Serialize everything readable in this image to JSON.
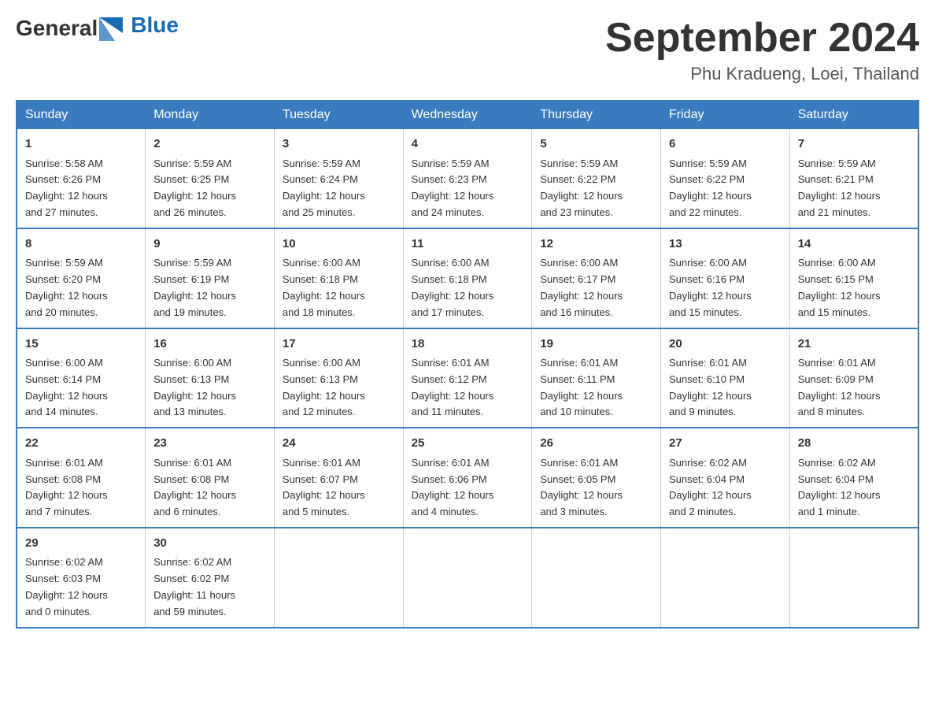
{
  "logo": {
    "text_general": "General",
    "text_blue": "Blue"
  },
  "header": {
    "title": "September 2024",
    "subtitle": "Phu Kradueng, Loei, Thailand"
  },
  "weekdays": [
    "Sunday",
    "Monday",
    "Tuesday",
    "Wednesday",
    "Thursday",
    "Friday",
    "Saturday"
  ],
  "weeks": [
    [
      {
        "day": "1",
        "sunrise": "5:58 AM",
        "sunset": "6:26 PM",
        "daylight": "12 hours and 27 minutes."
      },
      {
        "day": "2",
        "sunrise": "5:59 AM",
        "sunset": "6:25 PM",
        "daylight": "12 hours and 26 minutes."
      },
      {
        "day": "3",
        "sunrise": "5:59 AM",
        "sunset": "6:24 PM",
        "daylight": "12 hours and 25 minutes."
      },
      {
        "day": "4",
        "sunrise": "5:59 AM",
        "sunset": "6:23 PM",
        "daylight": "12 hours and 24 minutes."
      },
      {
        "day": "5",
        "sunrise": "5:59 AM",
        "sunset": "6:22 PM",
        "daylight": "12 hours and 23 minutes."
      },
      {
        "day": "6",
        "sunrise": "5:59 AM",
        "sunset": "6:22 PM",
        "daylight": "12 hours and 22 minutes."
      },
      {
        "day": "7",
        "sunrise": "5:59 AM",
        "sunset": "6:21 PM",
        "daylight": "12 hours and 21 minutes."
      }
    ],
    [
      {
        "day": "8",
        "sunrise": "5:59 AM",
        "sunset": "6:20 PM",
        "daylight": "12 hours and 20 minutes."
      },
      {
        "day": "9",
        "sunrise": "5:59 AM",
        "sunset": "6:19 PM",
        "daylight": "12 hours and 19 minutes."
      },
      {
        "day": "10",
        "sunrise": "6:00 AM",
        "sunset": "6:18 PM",
        "daylight": "12 hours and 18 minutes."
      },
      {
        "day": "11",
        "sunrise": "6:00 AM",
        "sunset": "6:18 PM",
        "daylight": "12 hours and 17 minutes."
      },
      {
        "day": "12",
        "sunrise": "6:00 AM",
        "sunset": "6:17 PM",
        "daylight": "12 hours and 16 minutes."
      },
      {
        "day": "13",
        "sunrise": "6:00 AM",
        "sunset": "6:16 PM",
        "daylight": "12 hours and 15 minutes."
      },
      {
        "day": "14",
        "sunrise": "6:00 AM",
        "sunset": "6:15 PM",
        "daylight": "12 hours and 15 minutes."
      }
    ],
    [
      {
        "day": "15",
        "sunrise": "6:00 AM",
        "sunset": "6:14 PM",
        "daylight": "12 hours and 14 minutes."
      },
      {
        "day": "16",
        "sunrise": "6:00 AM",
        "sunset": "6:13 PM",
        "daylight": "12 hours and 13 minutes."
      },
      {
        "day": "17",
        "sunrise": "6:00 AM",
        "sunset": "6:13 PM",
        "daylight": "12 hours and 12 minutes."
      },
      {
        "day": "18",
        "sunrise": "6:01 AM",
        "sunset": "6:12 PM",
        "daylight": "12 hours and 11 minutes."
      },
      {
        "day": "19",
        "sunrise": "6:01 AM",
        "sunset": "6:11 PM",
        "daylight": "12 hours and 10 minutes."
      },
      {
        "day": "20",
        "sunrise": "6:01 AM",
        "sunset": "6:10 PM",
        "daylight": "12 hours and 9 minutes."
      },
      {
        "day": "21",
        "sunrise": "6:01 AM",
        "sunset": "6:09 PM",
        "daylight": "12 hours and 8 minutes."
      }
    ],
    [
      {
        "day": "22",
        "sunrise": "6:01 AM",
        "sunset": "6:08 PM",
        "daylight": "12 hours and 7 minutes."
      },
      {
        "day": "23",
        "sunrise": "6:01 AM",
        "sunset": "6:08 PM",
        "daylight": "12 hours and 6 minutes."
      },
      {
        "day": "24",
        "sunrise": "6:01 AM",
        "sunset": "6:07 PM",
        "daylight": "12 hours and 5 minutes."
      },
      {
        "day": "25",
        "sunrise": "6:01 AM",
        "sunset": "6:06 PM",
        "daylight": "12 hours and 4 minutes."
      },
      {
        "day": "26",
        "sunrise": "6:01 AM",
        "sunset": "6:05 PM",
        "daylight": "12 hours and 3 minutes."
      },
      {
        "day": "27",
        "sunrise": "6:02 AM",
        "sunset": "6:04 PM",
        "daylight": "12 hours and 2 minutes."
      },
      {
        "day": "28",
        "sunrise": "6:02 AM",
        "sunset": "6:04 PM",
        "daylight": "12 hours and 1 minute."
      }
    ],
    [
      {
        "day": "29",
        "sunrise": "6:02 AM",
        "sunset": "6:03 PM",
        "daylight": "12 hours and 0 minutes."
      },
      {
        "day": "30",
        "sunrise": "6:02 AM",
        "sunset": "6:02 PM",
        "daylight": "11 hours and 59 minutes."
      },
      null,
      null,
      null,
      null,
      null
    ]
  ],
  "labels": {
    "sunrise": "Sunrise:",
    "sunset": "Sunset:",
    "daylight": "Daylight:"
  }
}
